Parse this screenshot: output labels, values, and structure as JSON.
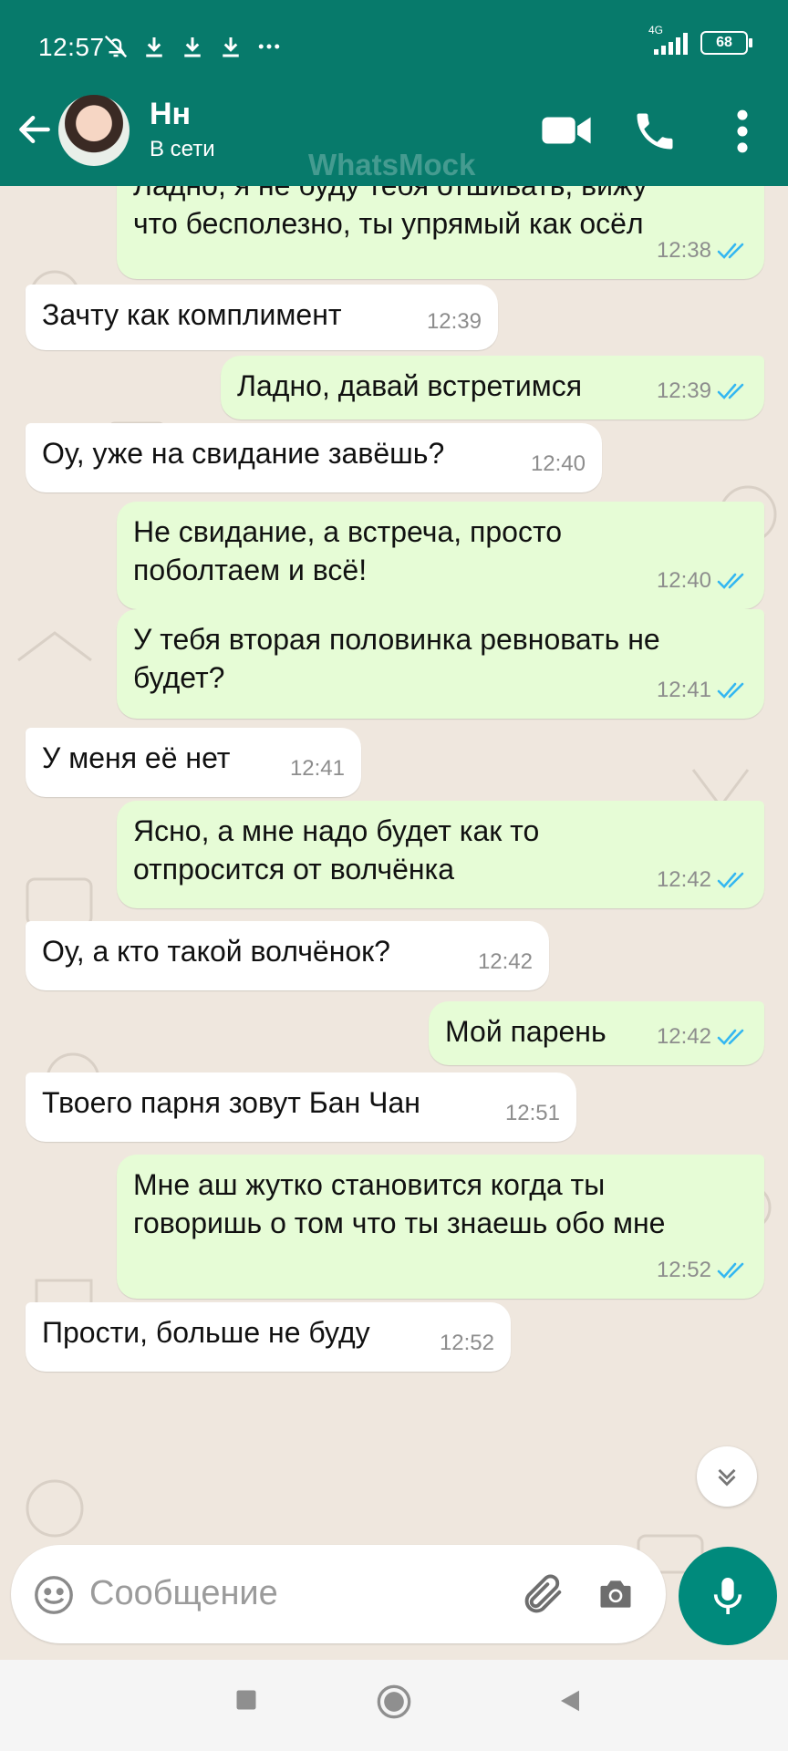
{
  "status_bar": {
    "time": "12:57",
    "network": "4G",
    "battery": "68"
  },
  "header": {
    "contact_name": "Нн",
    "contact_status": "В сети",
    "watermark": "WhatsMock",
    "icons": [
      "back-arrow-icon",
      "video-call-icon",
      "phone-icon",
      "more-vert-icon"
    ]
  },
  "colors": {
    "header": "#077a6b",
    "outgoing_bubble": "#e6fcd6",
    "incoming_bubble": "#ffffff",
    "read_ticks": "#34b7f1",
    "mic_button": "#008a7c"
  },
  "messages": [
    {
      "dir": "out",
      "text": "Ладно, я не буду тебя отшивать, вижу\nчто бесполезно, ты упрямый как осёл",
      "time": "12:38",
      "read": true
    },
    {
      "dir": "in",
      "text": "Зачту как комплимент",
      "time": "12:39"
    },
    {
      "dir": "out",
      "text": "Ладно, давай встретимся",
      "time": "12:39",
      "read": true
    },
    {
      "dir": "in",
      "text": "Оу, уже на свидание завёшь?",
      "time": "12:40"
    },
    {
      "dir": "out",
      "text": "Не свидание, а встреча, просто\nпоболтаем и всё!",
      "time": "12:40",
      "read": true
    },
    {
      "dir": "out",
      "text": "У тебя вторая половинка ревновать не\nбудет?",
      "time": "12:41",
      "read": true
    },
    {
      "dir": "in",
      "text": "У меня её нет",
      "time": "12:41"
    },
    {
      "dir": "out",
      "text": "Ясно, а мне надо будет как то\nотпросится от волчёнка",
      "time": "12:42",
      "read": true
    },
    {
      "dir": "in",
      "text": "Оу, а кто такой волчёнок?",
      "time": "12:42"
    },
    {
      "dir": "out",
      "text": "Мой парень",
      "time": "12:42",
      "read": true
    },
    {
      "dir": "in",
      "text": "Твоего парня зовут Бан Чан",
      "time": "12:51"
    },
    {
      "dir": "out",
      "text": "Мне аш жутко становится когда ты\nговоришь о том что ты знаешь обо мне",
      "time": "12:52",
      "read": true
    },
    {
      "dir": "in",
      "text": "Прости, больше не буду",
      "time": "12:52"
    }
  ],
  "composer": {
    "placeholder": "Сообщение"
  }
}
